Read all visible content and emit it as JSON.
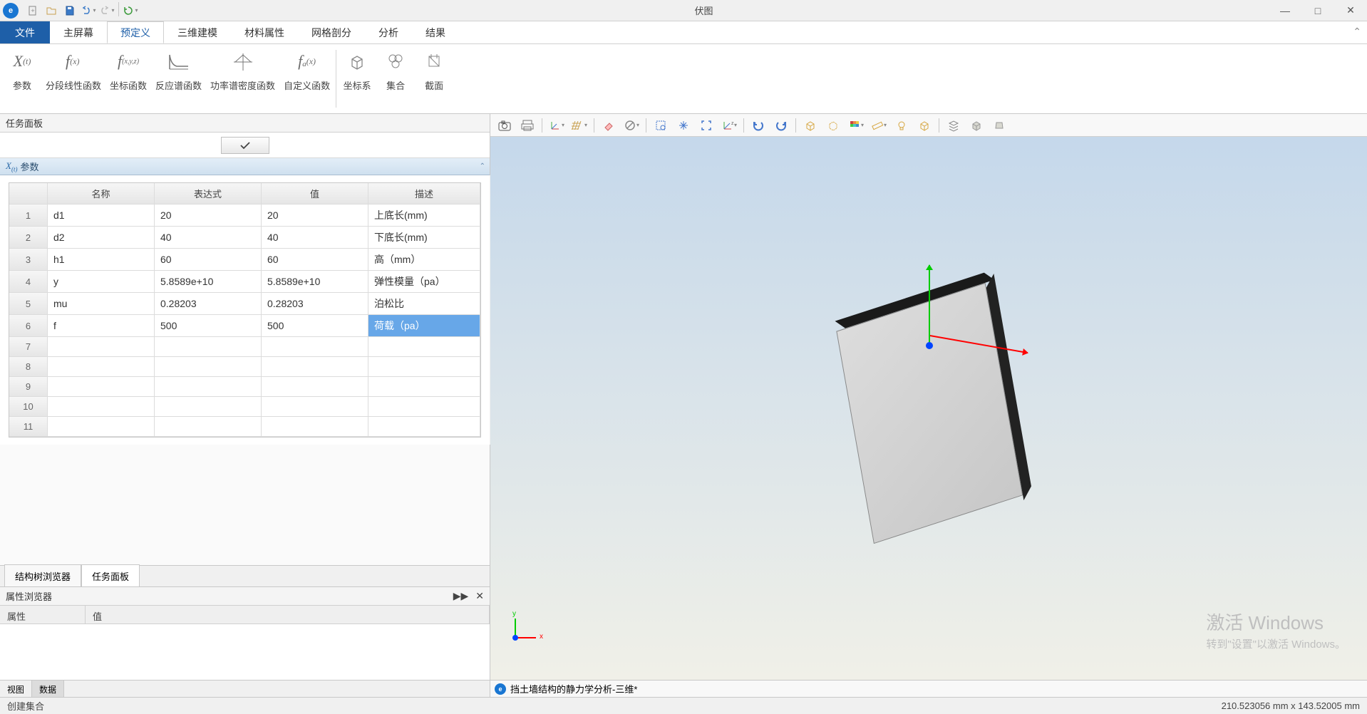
{
  "titlebar": {
    "title": "伏图"
  },
  "tabs": {
    "file": "文件",
    "items": [
      "主屏幕",
      "预定义",
      "三维建模",
      "材料属性",
      "网格剖分",
      "分析",
      "结果"
    ],
    "active_index": 1
  },
  "ribbon": {
    "group1": [
      {
        "icon": "X(t)",
        "label": "参数"
      },
      {
        "icon": "f(x)",
        "label": "分段线性函数"
      },
      {
        "icon": "f(x,y,z)",
        "label": "坐标函数"
      },
      {
        "icon": "curve",
        "label": "反应谱函数"
      },
      {
        "icon": "psd",
        "label": "功率谱密度函数"
      },
      {
        "icon": "fa(x)",
        "label": "自定义函数"
      }
    ],
    "group2": [
      {
        "icon": "cube",
        "label": "坐标系"
      },
      {
        "icon": "set",
        "label": "集合"
      },
      {
        "icon": "section",
        "label": "截面"
      }
    ]
  },
  "panels": {
    "task_panel": "任务面板",
    "param_section": "参数",
    "structure_tree": "结构树浏览器",
    "task_panel_tab": "任务面板",
    "property_browser": "属性浏览器",
    "prop_col1": "属性",
    "prop_col2": "值",
    "view_tab": "视图",
    "data_tab": "数据"
  },
  "param_table": {
    "headers": [
      "",
      "名称",
      "表达式",
      "值",
      "描述"
    ],
    "rows": [
      {
        "n": "1",
        "name": "d1",
        "expr": "20",
        "val": "20",
        "desc": "上底长(mm)"
      },
      {
        "n": "2",
        "name": "d2",
        "expr": "40",
        "val": "40",
        "desc": "下底长(mm)"
      },
      {
        "n": "3",
        "name": "h1",
        "expr": "60",
        "val": "60",
        "desc": "高（mm）"
      },
      {
        "n": "4",
        "name": "y",
        "expr": "5.8589e+10",
        "val": "5.8589e+10",
        "desc": "弹性模量（pa）"
      },
      {
        "n": "5",
        "name": "mu",
        "expr": "0.28203",
        "val": "0.28203",
        "desc": "泊松比"
      },
      {
        "n": "6",
        "name": "f",
        "expr": "500",
        "val": "500",
        "desc": "荷载（pa）",
        "selected_col": "desc"
      }
    ],
    "empty_rows": [
      "7",
      "8",
      "9",
      "10",
      "11"
    ]
  },
  "viewport": {
    "document": "挡土墙结构的静力学分析-三维*"
  },
  "watermark": {
    "line1": "激活 Windows",
    "line2": "转到\"设置\"以激活 Windows。"
  },
  "statusbar": {
    "left": "创建集合",
    "right": "210.523056 mm x 143.52005 mm"
  }
}
